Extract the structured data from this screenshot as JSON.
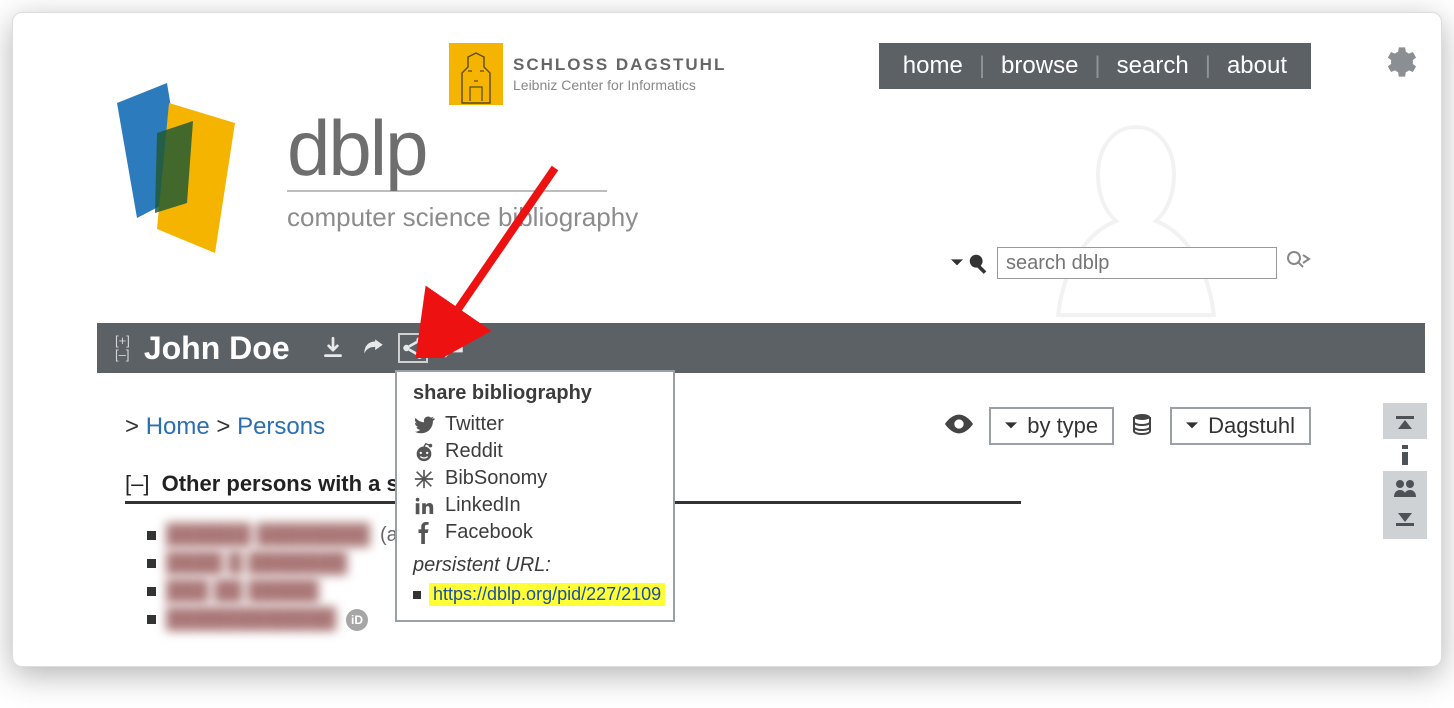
{
  "dagstuhl": {
    "line1": "SCHLOSS DAGSTUHL",
    "line2": "Leibniz Center for Informatics"
  },
  "nav": {
    "home": "home",
    "browse": "browse",
    "search": "search",
    "about": "about"
  },
  "logo": {
    "name": "dblp",
    "tagline": "computer science bibliography"
  },
  "searchbox": {
    "placeholder": "search dblp"
  },
  "person": {
    "name": "John Doe",
    "expand": "[+]",
    "collapse": "[–]"
  },
  "share": {
    "title": "share bibliography",
    "twitter": "Twitter",
    "reddit": "Reddit",
    "bibsonomy": "BibSonomy",
    "linkedin": "LinkedIn",
    "facebook": "Facebook",
    "url_label": "persistent URL:",
    "url": "https://dblp.org/pid/227/2109"
  },
  "breadcrumb": {
    "sep1": "> ",
    "home": "Home",
    "sep2": " > ",
    "persons": "Persons"
  },
  "controls": {
    "bytype": "by type",
    "dagstuhl": "Dagstuhl"
  },
  "subsection": {
    "toggle": "[–]",
    "label": "Other persons with a s"
  },
  "people": [
    {
      "name": "██████ ████████",
      "aka": "(aka: G"
    },
    {
      "name": "████ █ ███████",
      "aka": ""
    },
    {
      "name": "███ ██ █████",
      "aka": ""
    },
    {
      "name": "████████████",
      "aka": "",
      "orcid": true
    }
  ]
}
